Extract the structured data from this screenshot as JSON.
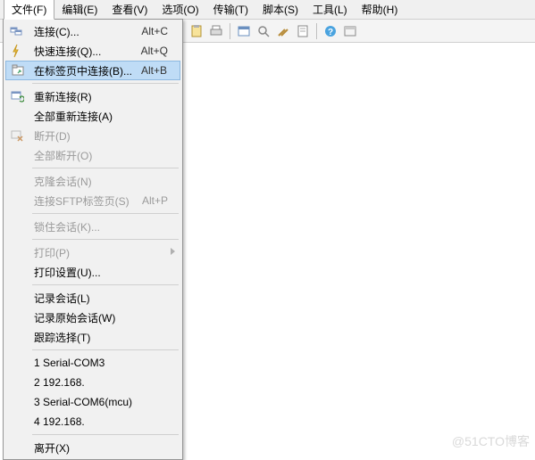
{
  "menubar": {
    "items": [
      "文件(F)",
      "编辑(E)",
      "查看(V)",
      "选项(O)",
      "传输(T)",
      "脚本(S)",
      "工具(L)",
      "帮助(H)"
    ]
  },
  "dropdown": {
    "rows": [
      {
        "label": "连接(C)...",
        "shortcut": "Alt+C",
        "icon": "connections-icon"
      },
      {
        "label": "快速连接(Q)...",
        "shortcut": "Alt+Q",
        "icon": "quick-connect-icon"
      },
      {
        "label": "在标签页中连接(B)...",
        "shortcut": "Alt+B",
        "icon": "tab-connect-icon",
        "highlight": true
      },
      {
        "sep": true
      },
      {
        "label": "重新连接(R)",
        "icon": "reconnect-icon"
      },
      {
        "label": "全部重新连接(A)"
      },
      {
        "label": "断开(D)",
        "icon": "disconnect-icon",
        "disabled": true
      },
      {
        "label": "全部断开(O)",
        "disabled": true
      },
      {
        "sep": true
      },
      {
        "label": "克隆会话(N)",
        "disabled": true
      },
      {
        "label": "连接SFTP标签页(S)",
        "shortcut": "Alt+P",
        "disabled": true
      },
      {
        "sep": true
      },
      {
        "label": "锁住会话(K)...",
        "disabled": true
      },
      {
        "sep": true
      },
      {
        "label": "打印(P)",
        "submenu": true,
        "disabled": true
      },
      {
        "label": "打印设置(U)..."
      },
      {
        "sep": true
      },
      {
        "label": "记录会话(L)"
      },
      {
        "label": "记录原始会话(W)"
      },
      {
        "label": "跟踪选择(T)"
      },
      {
        "sep": true
      },
      {
        "label": "1 Serial-COM3"
      },
      {
        "label": "2 192.168."
      },
      {
        "label": "3 Serial-COM6(mcu)"
      },
      {
        "label": "4 192.168."
      },
      {
        "sep": true
      },
      {
        "label": "离开(X)"
      }
    ]
  },
  "watermark": "@51CTO博客"
}
